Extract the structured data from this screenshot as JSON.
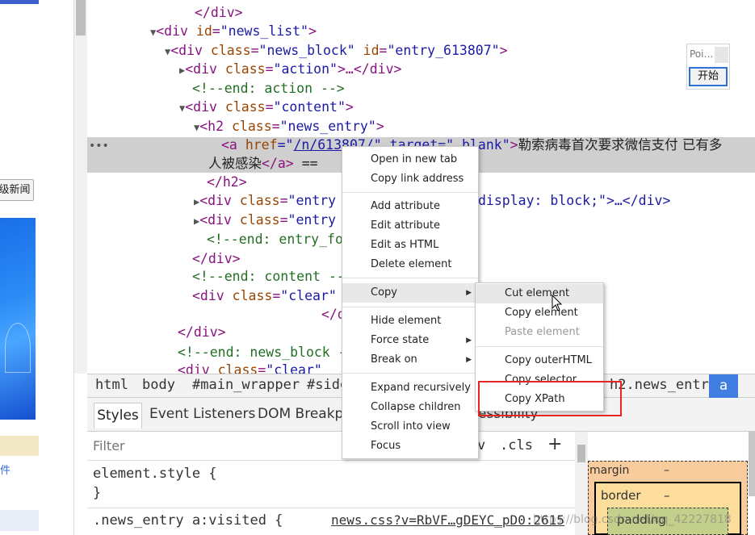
{
  "left_page": {
    "button_text": "级新闻",
    "link_text": "件"
  },
  "dom_tree": {
    "lines": [
      {
        "indent": 0,
        "text": "</div>"
      },
      {
        "text": "<div id=\"news_list\">"
      },
      {
        "text": "<div class=\"news_block\" id=\"entry_613807\">"
      },
      {
        "text": "<div class=\"action\">…</div>"
      },
      {
        "text": "<!--end: action -->"
      },
      {
        "text": "<div class=\"content\">"
      },
      {
        "text": "<h2 class=\"news_entry\">"
      }
    ],
    "l0": "</div>",
    "l1_tag_open": "<div ",
    "l1_attr": "id",
    "l1_val": "\"news_list\"",
    "l1_close": ">",
    "l2_tag_open": "<div ",
    "l2_attr1": "class",
    "l2_val1": "\"news_block\"",
    "l2_attr2": "id",
    "l2_val2": "\"entry_613807\"",
    "l2_close": ">",
    "l3_tag_open": "<div ",
    "l3_attr": "class",
    "l3_val": "\"action\"",
    "l3_close": ">…</div>",
    "l4": "<!--end: action -->",
    "l5_tag_open": "<div ",
    "l5_attr": "class",
    "l5_val": "\"content\"",
    "l5_close": ">",
    "l6_tag_open": "<h2 ",
    "l6_attr": "class",
    "l6_val": "\"news_entry\"",
    "l6_close": ">",
    "sel_a_open": "<a ",
    "sel_href": "href",
    "sel_eq": "=\"",
    "sel_href_val": "/n/613807/",
    "sel_target": "\" target=\"_blank\"",
    "sel_close": ">",
    "sel_text1": "勒索病毒首次要求微信支付 已有多",
    "sel_text2": "人被感染",
    "sel_end": "</a>",
    "sel_eq2": "==",
    "l9": "</h2>",
    "l10_tag_open": "<div ",
    "l10_attr": "class",
    "l10_val": "\"entry",
    "l10_rest": "display: block;\">…</div>",
    "l11_tag_open": "<div ",
    "l11_attr": "class",
    "l11_val": "\"entry",
    "l12": "<!--end: entry_fo",
    "l13": "</div>",
    "l14": "<!--end: content --",
    "l15_tag_open": "<div ",
    "l15_attr": "class",
    "l15_val": "\"clear\"",
    "l16": "</d",
    "l17": "</div>",
    "l18": "<!--end: news_block -",
    "l19_tag_open": "<div ",
    "l19_attr": "class",
    "l19_val": "\"clear\"",
    "dots": "•••"
  },
  "widget": {
    "title": "Poi…",
    "button": "开始"
  },
  "breadcrumb": {
    "items": [
      "html",
      "body",
      "#main_wrapper",
      "#side",
      "h2.news_entry",
      "a"
    ]
  },
  "tabs": {
    "items": [
      "Styles",
      "Event Listeners",
      "DOM Breakp",
      "essibility"
    ]
  },
  "styles": {
    "filter_placeholder": "Filter",
    "hov": "v",
    "cls": ".cls",
    "plus": "+",
    "element_style": "element.style {",
    "close_brace": "}",
    "rule_selector": ".news_entry a:visited {",
    "source_link": "news.css?v=RbVF…gDEYC_pD0:2615"
  },
  "box_model": {
    "margin": "margin",
    "border": "border",
    "padding": "padding",
    "dash": "–"
  },
  "watermark": "https://blog.csdn.net/qq_42227818",
  "context_menu": {
    "items": [
      "Open in new tab",
      "Copy link address",
      "Add attribute",
      "Edit attribute",
      "Edit as HTML",
      "Delete element",
      "Copy",
      "Hide element",
      "Force state",
      "Break on",
      "Expand recursively",
      "Collapse children",
      "Scroll into view",
      "Focus"
    ]
  },
  "copy_submenu": {
    "items": [
      "Cut element",
      "Copy element",
      "Paste element",
      "Copy outerHTML",
      "Copy selector",
      "Copy XPath"
    ]
  },
  "colors": {
    "tag": "#881280",
    "attr_name": "#994500",
    "attr_value": "#1a1aa6",
    "comment": "#236e25",
    "highlight_box": "#e32727",
    "selected_crumb": "#3f7ee0"
  }
}
